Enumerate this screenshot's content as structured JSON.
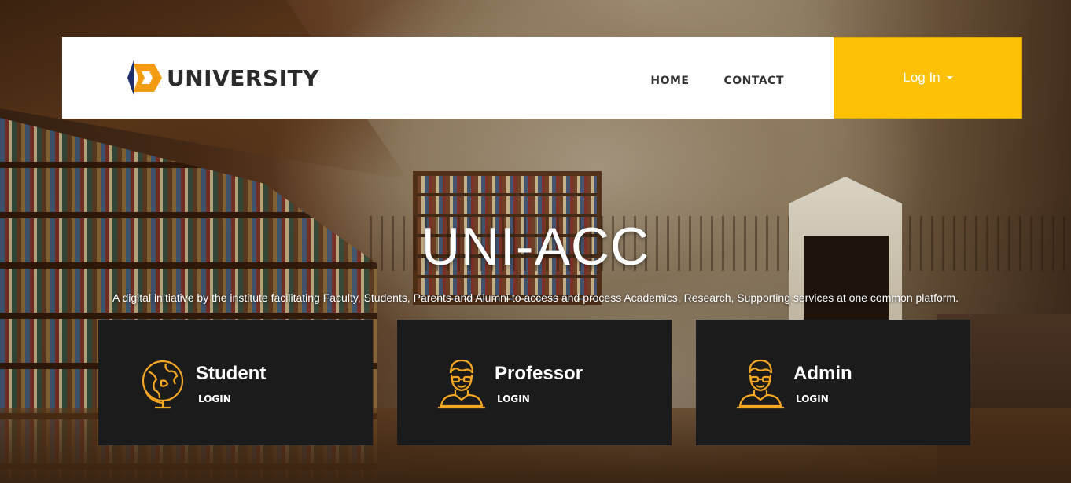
{
  "colors": {
    "accent": "#ffc107",
    "card_bg": "#1b1b1b",
    "icon": "#f5a623",
    "logo_orange": "#f39c12",
    "logo_navy": "#1f2f6b"
  },
  "header": {
    "logo_icon": "university-logo-icon",
    "logo_text": "UNIVERSITY",
    "nav": [
      {
        "label": "HOME"
      },
      {
        "label": "CONTACT"
      }
    ],
    "login_label": "Log In"
  },
  "hero": {
    "title": "UNI-ACC",
    "subtitle": "A digital initiative by the institute facilitating Faculty, Students, Parents and Alumni to access and process Academics, Research, Supporting services at one common platform."
  },
  "cards": [
    {
      "icon": "globe-icon",
      "title": "Student",
      "link": "LOGIN"
    },
    {
      "icon": "professor-icon",
      "title": "Professor",
      "link": "LOGIN"
    },
    {
      "icon": "admin-icon",
      "title": "Admin",
      "link": "LOGIN"
    }
  ]
}
